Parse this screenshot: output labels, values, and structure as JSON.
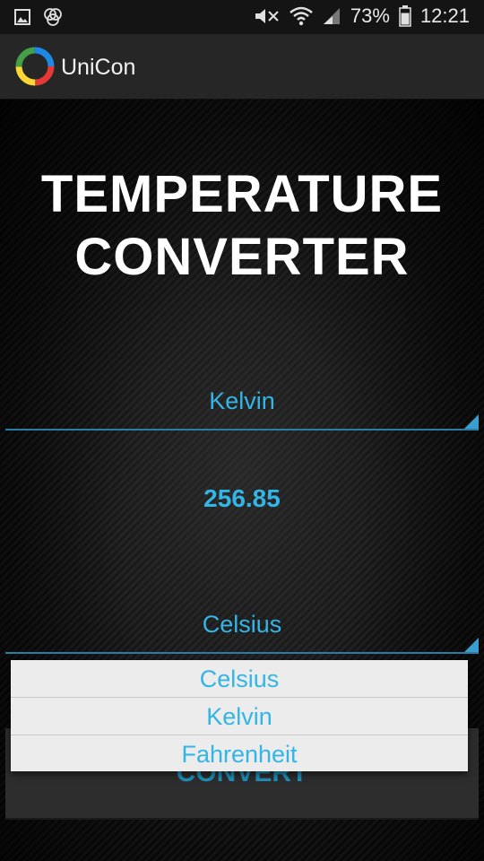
{
  "status_bar": {
    "battery": "73%",
    "time": "12:21"
  },
  "action_bar": {
    "title": "UniCon"
  },
  "main": {
    "title_line1": "TEMPERATURE",
    "title_line2": "CONVERTER",
    "from_unit": "Kelvin",
    "value": "256.85",
    "to_unit": "Celsius",
    "convert_label": "CONVERT"
  },
  "dropdown": {
    "options": [
      "Celsius",
      "Kelvin",
      "Fahrenheit"
    ]
  },
  "colors": {
    "accent": "#33b5e5",
    "status_bar": "#141414",
    "action_bar": "#262626",
    "dropdown_bg": "#ececec"
  }
}
